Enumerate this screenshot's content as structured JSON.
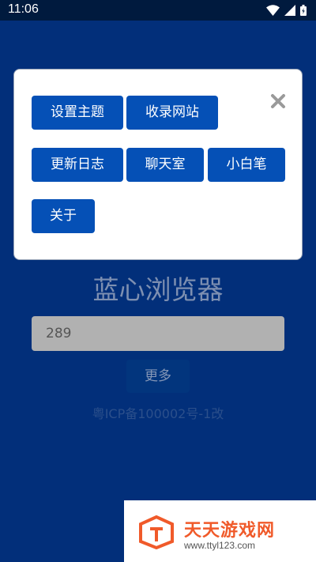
{
  "status_bar": {
    "time": "11:06",
    "icons": [
      "wifi-icon",
      "signal-icon",
      "battery-icon"
    ]
  },
  "main": {
    "title": "蓝心浏览器",
    "search_value": "289",
    "more_label": "更多",
    "icp": "粤ICP备100002号-1改"
  },
  "dialog": {
    "close_icon": "close-icon",
    "buttons": [
      "设置主题",
      "收录网站",
      "更新日志",
      "聊天室",
      "小白笔",
      "关于"
    ]
  },
  "watermark": {
    "name": "天天游戏网",
    "url": "www.ttyl123.com"
  },
  "colors": {
    "app_background": "#022f7a",
    "button_blue": "#0550b6",
    "status_bar": "#001a3e",
    "watermark_orange": "#f05a2a"
  }
}
